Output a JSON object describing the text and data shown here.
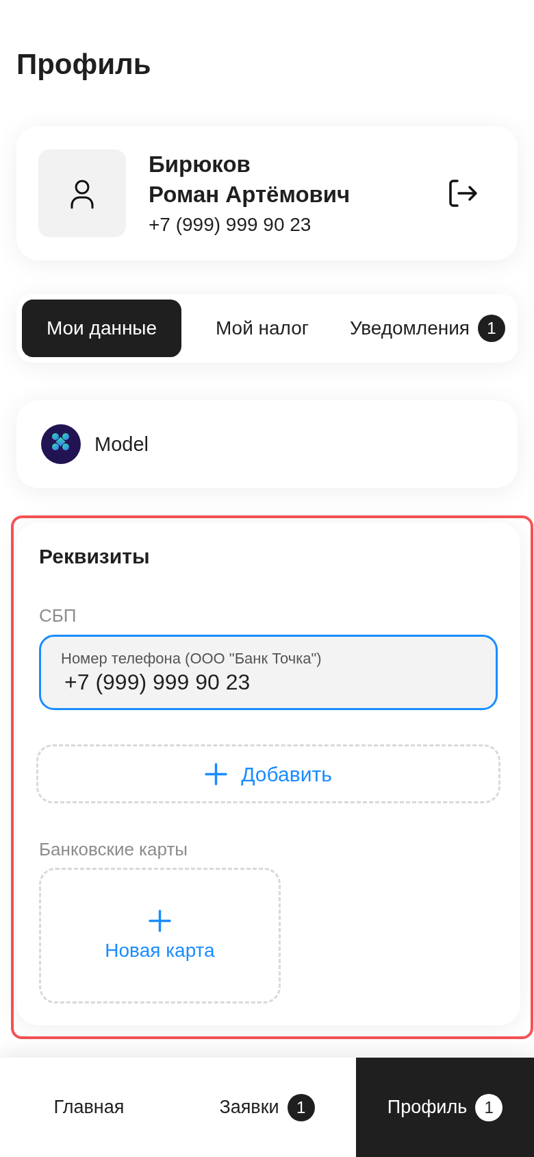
{
  "header": {
    "title": "Профиль"
  },
  "profile": {
    "surname": "Бирюков",
    "given_names": "Роман Артёмович",
    "phone": "+7 (999) 999 90 23"
  },
  "tabs": [
    {
      "label": "Мои данные",
      "selected": true
    },
    {
      "label": "Мой налог",
      "selected": false
    },
    {
      "label": "Уведомления",
      "selected": false,
      "badge": "1"
    }
  ],
  "organization": {
    "name": "Model"
  },
  "requisites": {
    "highlighted": true,
    "title": "Реквизиты",
    "sbp": {
      "label": "СБП",
      "field": {
        "label": "Номер телефона (ООО \"Банк Точка\")",
        "value": "+7 (999) 999 90 23",
        "focused": true
      },
      "add_button": "Добавить"
    },
    "cards": {
      "label": "Банковские карты",
      "new_card_button": "Новая карта"
    }
  },
  "bottom_nav": [
    {
      "label": "Главная",
      "selected": false
    },
    {
      "label": "Заявки",
      "selected": false,
      "badge": "1"
    },
    {
      "label": "Профиль",
      "selected": true,
      "badge": "1"
    }
  ]
}
